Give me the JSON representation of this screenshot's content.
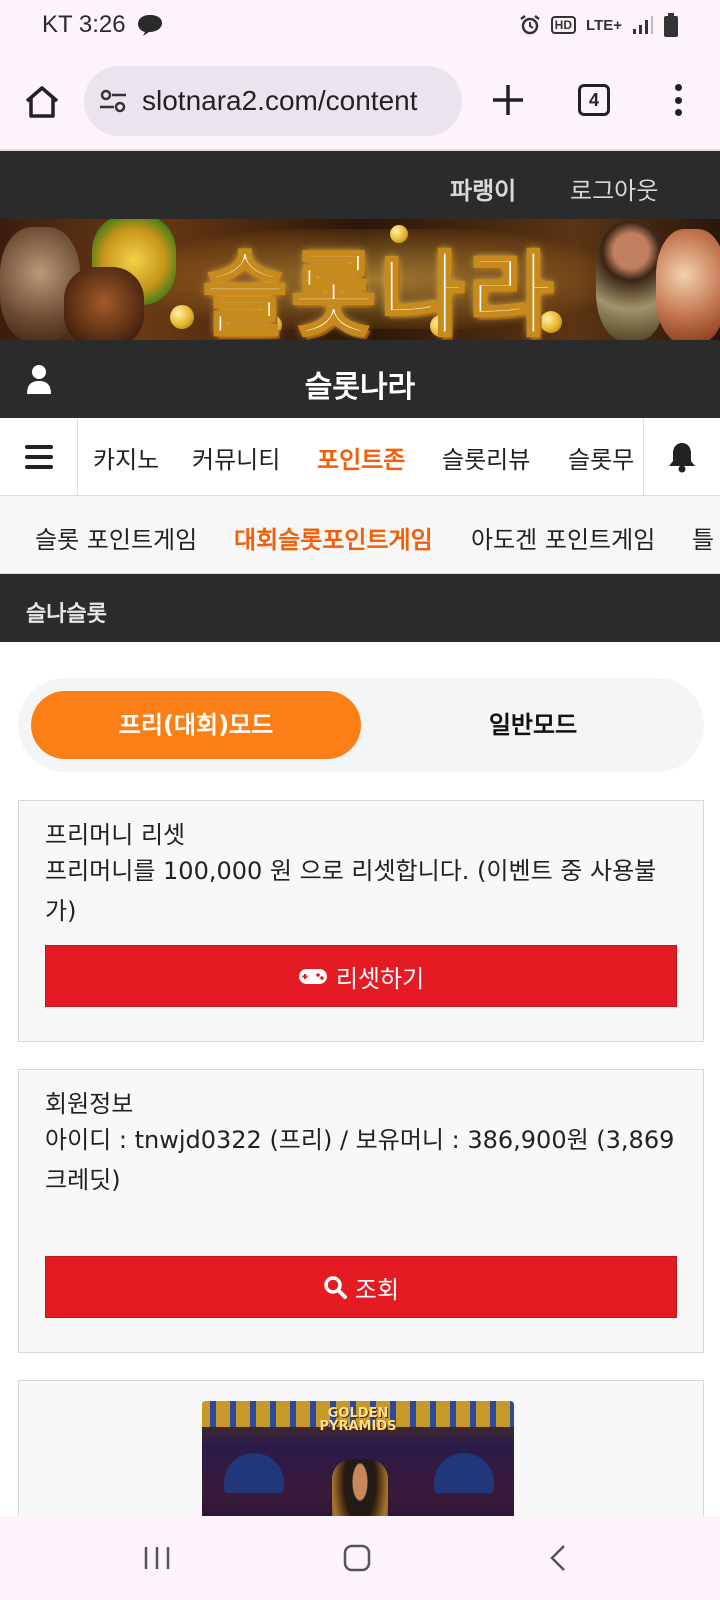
{
  "status_bar": {
    "carrier_time": "KT 3:26",
    "network": "LTE+",
    "hd_label": "HD"
  },
  "browser": {
    "url": "slotnara2.com/content",
    "tab_count": "4"
  },
  "header": {
    "nickname": "파랭이",
    "logout": "로그아웃",
    "banner_title": "슬롯나라",
    "site_title": "슬롯나라"
  },
  "main_nav": {
    "items": [
      {
        "label": "카지노",
        "active": false
      },
      {
        "label": "커뮤니티",
        "active": false
      },
      {
        "label": "포인트존",
        "active": true
      },
      {
        "label": "슬롯리뷰",
        "active": false
      },
      {
        "label": "슬롯무",
        "active": false
      }
    ]
  },
  "sub_nav": {
    "items": [
      {
        "label": "슬롯 포인트게임",
        "active": false
      },
      {
        "label": "대회슬롯포인트게임",
        "active": true
      },
      {
        "label": "아도겐 포인트게임",
        "active": false
      },
      {
        "label": "틀",
        "active": false
      }
    ]
  },
  "section": {
    "title": "슬나슬롯"
  },
  "mode_toggle": {
    "free_label": "프리(대회)모드",
    "normal_label": "일반모드",
    "selected": "free"
  },
  "reset_card": {
    "heading": "프리머니 리셋",
    "text": "프리머니를 100,000 원 으로 리셋합니다. (이벤트 중 사용불가)",
    "button_label": "리셋하기"
  },
  "member_card": {
    "heading": "회원정보",
    "text": "아이디 : tnwjd0322 (프리) / 보유머니 : 386,900원 (3,869 크레딧)",
    "button_label": "조회"
  },
  "game_card": {
    "game_title_line1": "GOLDEN",
    "game_title_line2": "PYRAMIDS"
  },
  "colors": {
    "accent_orange": "#f2600c",
    "toggle_orange": "#fb7f16",
    "button_red": "#e51b23",
    "dark_bar": "#2b2b2b"
  }
}
